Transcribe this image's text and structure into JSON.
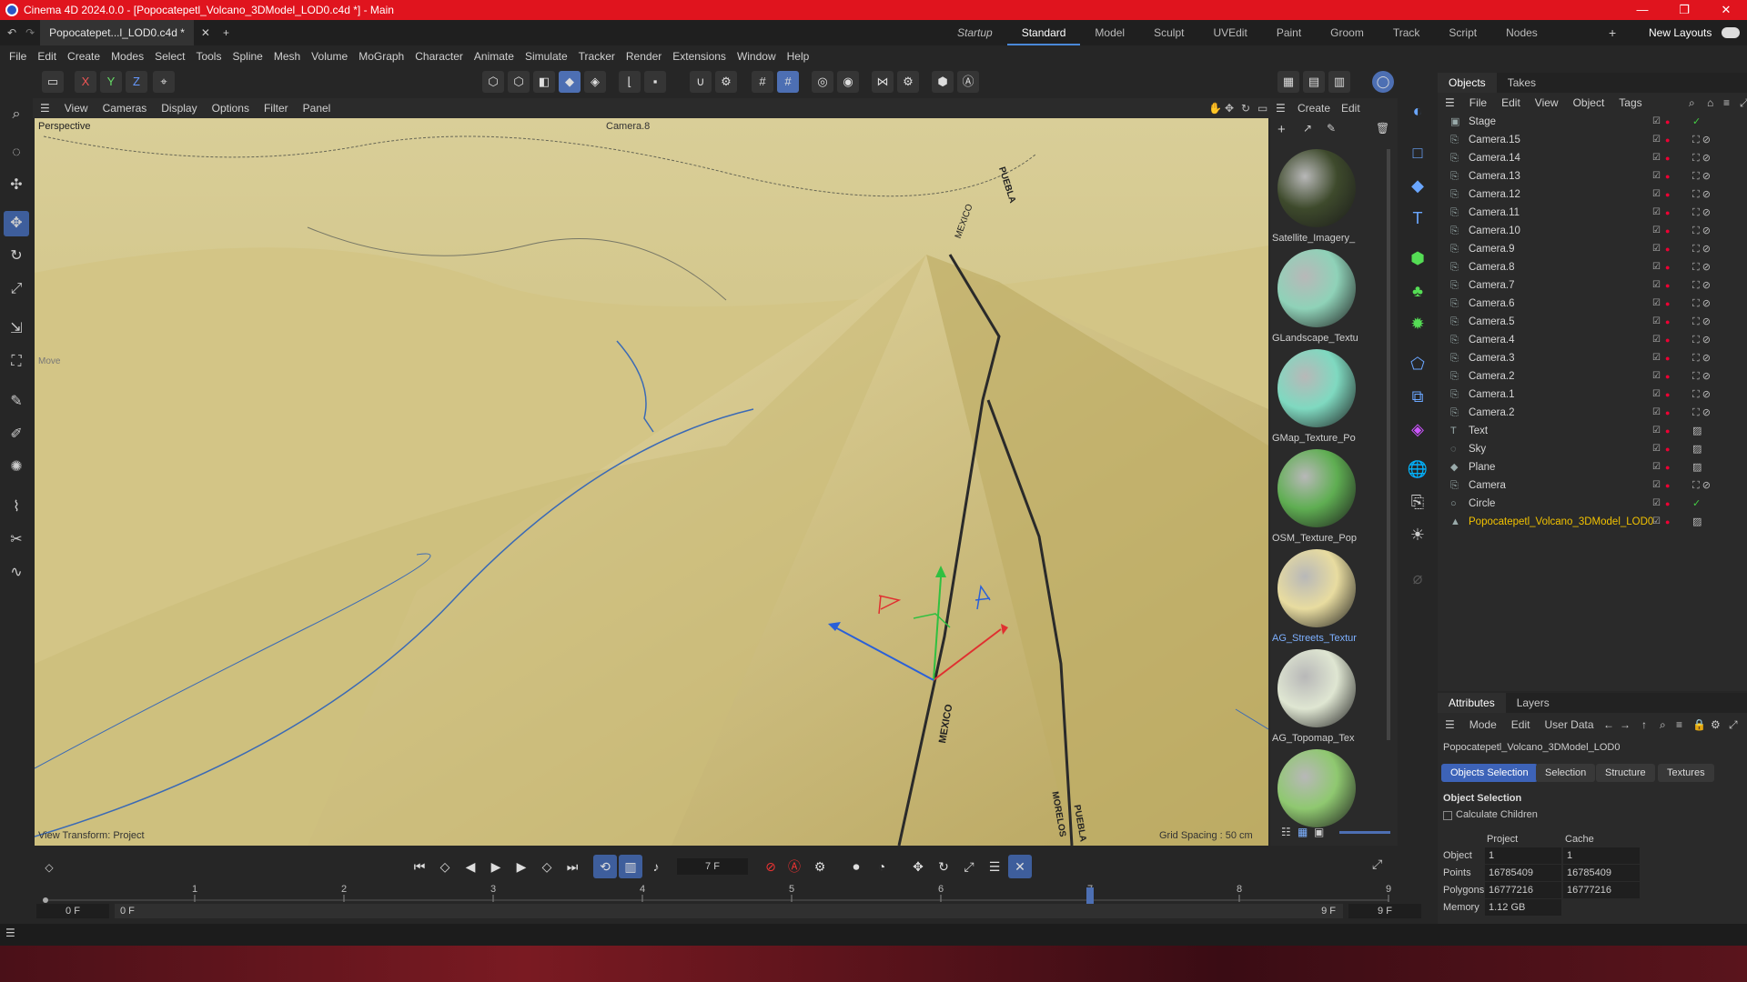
{
  "window": {
    "title": "Cinema 4D 2024.0.0 - [Popocatepetl_Volcano_3DModel_LOD0.c4d *] - Main",
    "controls": [
      "—",
      "❐",
      "✕"
    ]
  },
  "tabs": {
    "document": "Popocatepet...l_LOD0.c4d *",
    "layouts": [
      "Startup",
      "Standard",
      "Model",
      "Sculpt",
      "UVEdit",
      "Paint",
      "Groom",
      "Track",
      "Script",
      "Nodes"
    ],
    "active_layout": "Standard",
    "new_layouts": "New Layouts"
  },
  "menu": [
    "File",
    "Edit",
    "Create",
    "Modes",
    "Select",
    "Tools",
    "Spline",
    "Mesh",
    "Volume",
    "MoGraph",
    "Character",
    "Animate",
    "Simulate",
    "Tracker",
    "Render",
    "Extensions",
    "Window",
    "Help"
  ],
  "axis_lock": [
    "X",
    "Y",
    "Z"
  ],
  "viewport": {
    "menu": [
      "View",
      "Cameras",
      "Display",
      "Options",
      "Filter",
      "Panel"
    ],
    "view_name": "Perspective",
    "camera": "Camera.8",
    "view_transform": "View Transform: Project",
    "grid_spacing": "Grid Spacing : 50 cm",
    "move_label": "Move",
    "map_labels": [
      "MEXICO",
      "PUEBLA",
      "MEXICO",
      "PUEBLA",
      "MORELOS"
    ]
  },
  "materials": {
    "menu": [
      "Create",
      "Edit"
    ],
    "items": [
      {
        "name": "Satellite_Imagery_",
        "color": "#3e4a2c"
      },
      {
        "name": "GLandscape_Textu",
        "color": "#8fd2b8"
      },
      {
        "name": "GMap_Texture_Po",
        "color": "#7fd9c0"
      },
      {
        "name": "OSM_Texture_Pop",
        "color": "#5fae52"
      },
      {
        "name": "AG_Streets_Textur",
        "color": "#e8dca0"
      },
      {
        "name": "AG_Topomap_Tex",
        "color": "#dfe6d2"
      },
      {
        "name": "",
        "color": "#8fc870"
      }
    ],
    "selected_index": 4
  },
  "objects": {
    "tabs": [
      "Objects",
      "Takes"
    ],
    "menu": [
      "File",
      "Edit",
      "View",
      "Object",
      "Tags"
    ],
    "items": [
      {
        "name": "Stage",
        "icon": "stage-icon"
      },
      {
        "name": "Camera.15",
        "icon": "camera-icon"
      },
      {
        "name": "Camera.14",
        "icon": "camera-icon"
      },
      {
        "name": "Camera.13",
        "icon": "camera-icon"
      },
      {
        "name": "Camera.12",
        "icon": "camera-icon"
      },
      {
        "name": "Camera.11",
        "icon": "camera-icon"
      },
      {
        "name": "Camera.10",
        "icon": "camera-icon"
      },
      {
        "name": "Camera.9",
        "icon": "camera-icon"
      },
      {
        "name": "Camera.8",
        "icon": "camera-icon"
      },
      {
        "name": "Camera.7",
        "icon": "camera-icon"
      },
      {
        "name": "Camera.6",
        "icon": "camera-icon"
      },
      {
        "name": "Camera.5",
        "icon": "camera-icon"
      },
      {
        "name": "Camera.4",
        "icon": "camera-icon"
      },
      {
        "name": "Camera.3",
        "icon": "camera-icon"
      },
      {
        "name": "Camera.2",
        "icon": "camera-icon"
      },
      {
        "name": "Camera.1",
        "icon": "camera-icon"
      },
      {
        "name": "Camera.2",
        "icon": "camera-icon"
      },
      {
        "name": "Text",
        "icon": "text-icon"
      },
      {
        "name": "Sky",
        "icon": "sky-icon"
      },
      {
        "name": "Plane",
        "icon": "plane-icon"
      },
      {
        "name": "Camera",
        "icon": "camera-icon"
      },
      {
        "name": "Circle",
        "icon": "circle-icon"
      },
      {
        "name": "Popocatepetl_Volcano_3DModel_LOD0",
        "icon": "mesh-icon"
      }
    ],
    "selected_color": "#f2c200"
  },
  "attributes": {
    "tabs": [
      "Attributes",
      "Layers"
    ],
    "menu": [
      "Mode",
      "Edit",
      "User Data"
    ],
    "object_name": "Popocatepetl_Volcano_3DModel_LOD0",
    "buttons": [
      "Objects Selection",
      "Selection",
      "Structure",
      "Textures"
    ],
    "section": "Object Selection",
    "calc_children": "Calculate Children",
    "col_headers": [
      "Project",
      "Cache"
    ],
    "rows": [
      {
        "label": "Object",
        "project": "1",
        "cache": "1"
      },
      {
        "label": "Points",
        "project": "16785409",
        "cache": "16785409"
      },
      {
        "label": "Polygons",
        "project": "16777216",
        "cache": "16777216"
      },
      {
        "label": "Memory",
        "project": "1.12 GB",
        "cache": ""
      }
    ]
  },
  "timeline": {
    "current_frame": "7 F",
    "start": "0 F",
    "start2": "0 F",
    "end": "9 F",
    "end2": "9 F",
    "ticks": [
      "1",
      "2",
      "3",
      "4",
      "5",
      "6",
      "7",
      "8",
      "9"
    ],
    "tick_values": [
      1,
      2,
      3,
      4,
      5,
      6,
      7,
      8,
      9
    ],
    "playhead": 7,
    "range": [
      0,
      9
    ]
  },
  "colors": {
    "accent": "#4d6fb3",
    "titlebar": "#e0141e",
    "terrain": "#c9bb78"
  }
}
